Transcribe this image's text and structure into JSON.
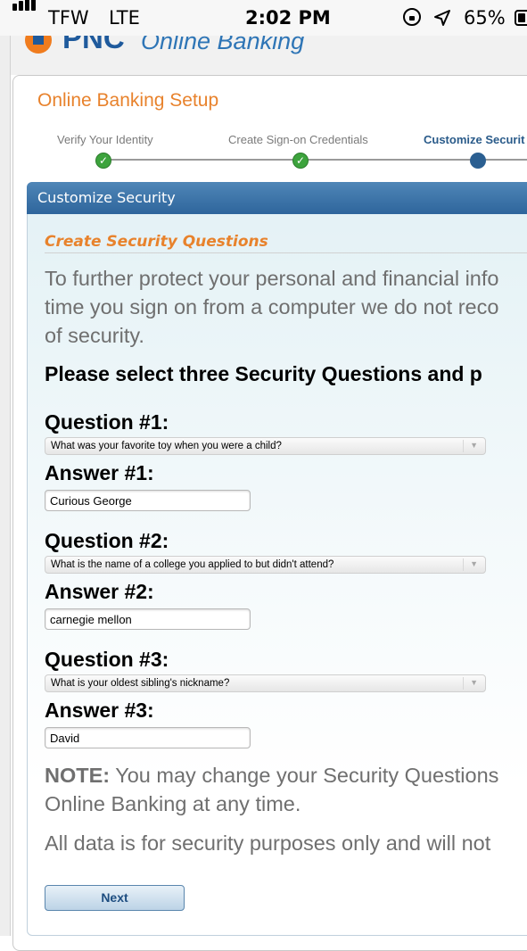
{
  "status_bar": {
    "carrier": "TFW",
    "network": "LTE",
    "time": "2:02 PM",
    "battery_pct": "65%",
    "icons": [
      "signal-bars-icon",
      "orientation-lock-icon",
      "location-arrow-icon",
      "battery-icon"
    ]
  },
  "header": {
    "brand": "PNC",
    "subtitle": "Online Banking"
  },
  "setup_title": "Online Banking Setup",
  "progress": {
    "steps": [
      {
        "label": "Verify Your Identity",
        "state": "complete"
      },
      {
        "label": "Create Sign-on Credentials",
        "state": "complete"
      },
      {
        "label": "Customize Securit",
        "state": "current"
      }
    ]
  },
  "panel": {
    "title": "Customize Security",
    "section_title": "Create Security Questions",
    "intro_lines": [
      "To further protect your personal and financial info",
      "time you sign on from a computer we do not reco",
      "of security."
    ],
    "instruction": "Please select three Security Questions and p"
  },
  "questions": [
    {
      "label": "Question #1:",
      "selected": "What was your favorite toy when you were a child?",
      "answer_label": "Answer #1:",
      "answer": "Curious George"
    },
    {
      "label": "Question #2:",
      "selected": "What is the name of a college you applied to but didn't attend?",
      "answer_label": "Answer #2:",
      "answer": "carnegie mellon"
    },
    {
      "label": "Question #3:",
      "selected": "What is your oldest sibling's nickname?",
      "answer_label": "Answer #3:",
      "answer": "David"
    }
  ],
  "note": {
    "prefix": "NOTE:",
    "line1": " You may change your Security Questions",
    "line2": "Online Banking at any time."
  },
  "disclaimer": "All data is for security purposes only and will not",
  "next_label": "Next",
  "colors": {
    "accent_orange": "#e8822c",
    "brand_blue": "#1f5a9c",
    "panel_header": "#3a72a8",
    "check_green": "#3da33d"
  }
}
